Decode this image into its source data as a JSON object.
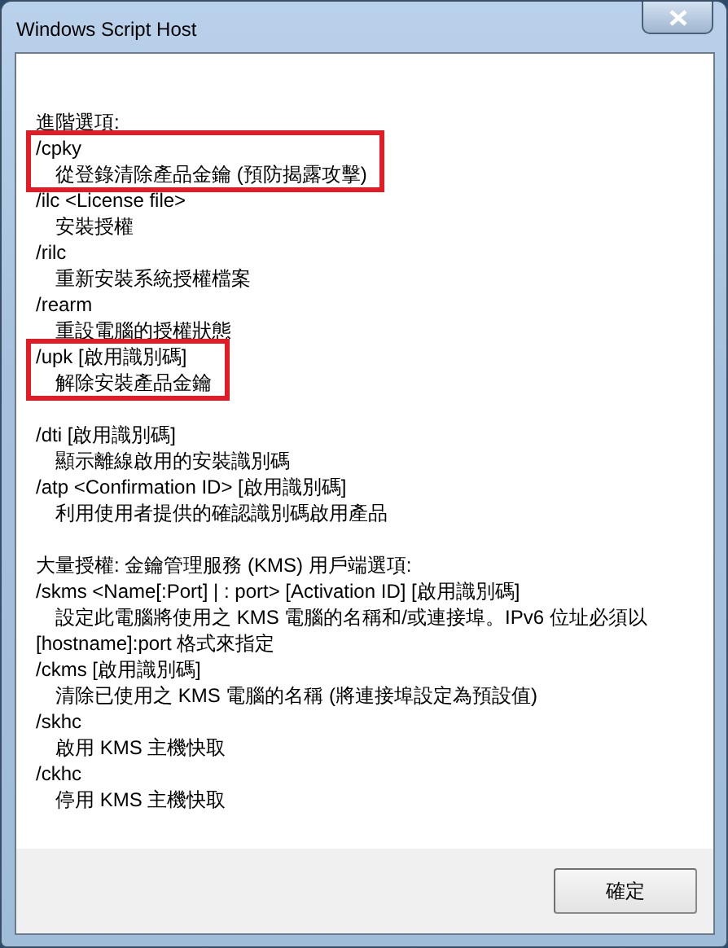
{
  "window": {
    "title": "Windows Script Host"
  },
  "sections": [
    {
      "heading": "進階選項:",
      "entries": [
        {
          "switch": "/cpky",
          "description": "從登錄清除產品金鑰 (預防揭露攻擊)",
          "highlighted": true
        },
        {
          "switch": "/ilc <License file>",
          "description": "安裝授權",
          "highlighted": false
        },
        {
          "switch": "/rilc",
          "description": "重新安裝系統授權檔案",
          "highlighted": false
        },
        {
          "switch": "/rearm",
          "description": "重設電腦的授權狀態",
          "highlighted": false
        },
        {
          "switch": "/upk [啟用識別碼]",
          "description": "解除安裝產品金鑰",
          "highlighted": true
        }
      ]
    },
    {
      "entries": [
        {
          "switch": "/dti [啟用識別碼]",
          "description": "顯示離線啟用的安裝識別碼",
          "highlighted": false
        },
        {
          "switch": "/atp <Confirmation ID> [啟用識別碼]",
          "description": "利用使用者提供的確認識別碼啟用產品",
          "highlighted": false
        }
      ]
    },
    {
      "heading": "大量授權: 金鑰管理服務 (KMS) 用戶端選項:",
      "entries": [
        {
          "switch": "/skms <Name[:Port] | : port> [Activation ID] [啟用識別碼]",
          "description": "設定此電腦將使用之 KMS 電腦的名稱和/或連接埠。IPv6 位址必須以",
          "continuation": "[hostname]:port 格式來指定",
          "highlighted": false
        },
        {
          "switch": "/ckms [啟用識別碼]",
          "description": "清除已使用之 KMS 電腦的名稱 (將連接埠設定為預設值)",
          "highlighted": false
        },
        {
          "switch": "/skhc",
          "description": "啟用 KMS 主機快取",
          "highlighted": false
        },
        {
          "switch": "/ckhc",
          "description": "停用 KMS 主機快取",
          "highlighted": false
        }
      ]
    }
  ],
  "buttons": [
    "確定"
  ]
}
